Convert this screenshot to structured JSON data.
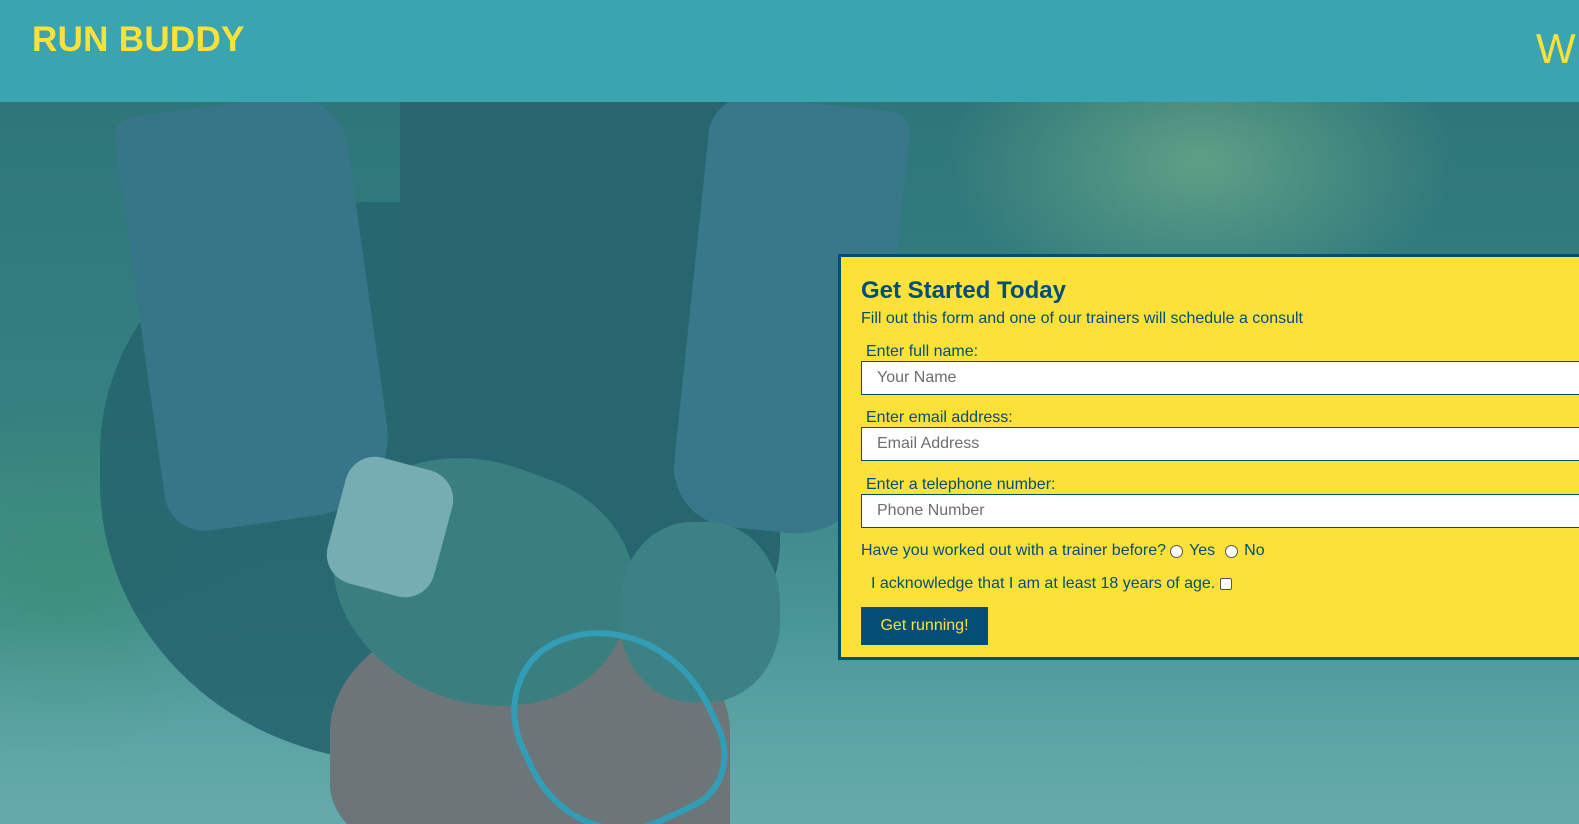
{
  "header": {
    "logo": "RUN BUDDY",
    "nav_partial": "W"
  },
  "hero": {
    "image_icon": "runner-tying-shoe-photo"
  },
  "form": {
    "title": "Get Started Today",
    "subtitle": "Fill out this form and one of our trainers will schedule a consult",
    "name_label": "Enter full name:",
    "name_placeholder": "Your Name",
    "email_label": "Enter email address:",
    "email_placeholder": "Email Address",
    "phone_label": "Enter a telephone number:",
    "phone_placeholder": "Phone Number",
    "trainer_question": "Have you worked out with a trainer before?",
    "yes_label": "Yes",
    "no_label": "No",
    "acknowledge_label": "I acknowledge that I am at least 18 years of age.",
    "submit_label": "Get running!"
  },
  "colors": {
    "header_bg": "#3aa5b1",
    "accent_yellow": "#fce138",
    "dark_blue": "#024e76"
  }
}
